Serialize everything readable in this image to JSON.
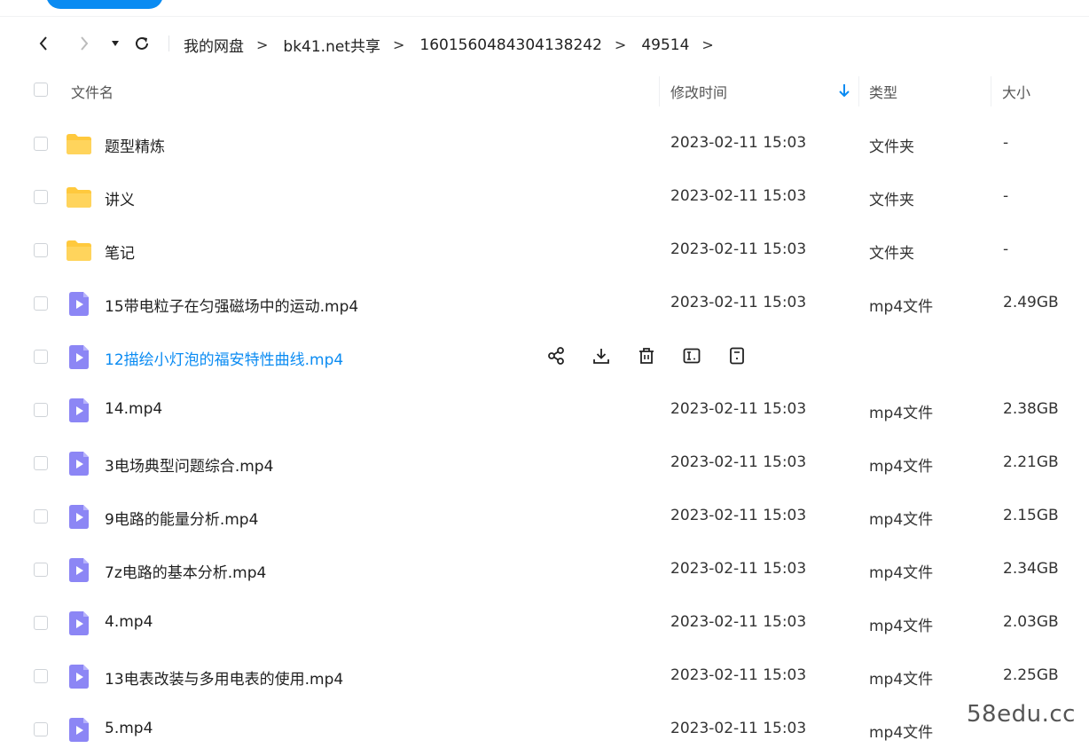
{
  "breadcrumb": {
    "items": [
      "我的网盘",
      "bk41.net共享",
      "1601560484304138242",
      "49514"
    ],
    "separator": ">"
  },
  "table": {
    "headers": {
      "name": "文件名",
      "time": "修改时间",
      "type": "类型",
      "size": "大小"
    },
    "sort": {
      "column": "修改时间",
      "direction": "desc"
    },
    "rows": [
      {
        "name": "题型精炼",
        "time": "2023-02-11 15:03",
        "type": "文件夹",
        "size": "-",
        "icon": "folder-icon"
      },
      {
        "name": "讲义",
        "time": "2023-02-11 15:03",
        "type": "文件夹",
        "size": "-",
        "icon": "folder-icon"
      },
      {
        "name": "笔记",
        "time": "2023-02-11 15:03",
        "type": "文件夹",
        "size": "-",
        "icon": "folder-icon"
      },
      {
        "name": "15带电粒子在匀强磁场中的运动.mp4",
        "time": "2023-02-11 15:03",
        "type": "mp4文件",
        "size": "2.49GB",
        "icon": "video-file-icon"
      },
      {
        "name": "12描绘小灯泡的福安特性曲线.mp4",
        "time": "",
        "type": "",
        "size": "",
        "icon": "video-file-icon",
        "hovered": true
      },
      {
        "name": "14.mp4",
        "time": "2023-02-11 15:03",
        "type": "mp4文件",
        "size": "2.38GB",
        "icon": "video-file-icon"
      },
      {
        "name": "3电场典型问题综合.mp4",
        "time": "2023-02-11 15:03",
        "type": "mp4文件",
        "size": "2.21GB",
        "icon": "video-file-icon"
      },
      {
        "name": "9电路的能量分析.mp4",
        "time": "2023-02-11 15:03",
        "type": "mp4文件",
        "size": "2.15GB",
        "icon": "video-file-icon"
      },
      {
        "name": "7z电路的基本分析.mp4",
        "time": "2023-02-11 15:03",
        "type": "mp4文件",
        "size": "2.34GB",
        "icon": "video-file-icon"
      },
      {
        "name": "4.mp4",
        "time": "2023-02-11 15:03",
        "type": "mp4文件",
        "size": "2.03GB",
        "icon": "video-file-icon"
      },
      {
        "name": "13电表改装与多用电表的使用.mp4",
        "time": "2023-02-11 15:03",
        "type": "mp4文件",
        "size": "2.25GB",
        "icon": "video-file-icon"
      },
      {
        "name": "5.mp4",
        "time": "2023-02-11 15:03",
        "type": "mp4文件",
        "size": "",
        "icon": "video-file-icon"
      }
    ],
    "row_actions": [
      "share-icon",
      "download-icon",
      "delete-icon",
      "rename-icon",
      "details-icon"
    ]
  },
  "watermark": "58edu.cc",
  "colors": {
    "accent": "#0a8bf2",
    "folder": "#ffc93d",
    "video": "#8c86f5"
  }
}
